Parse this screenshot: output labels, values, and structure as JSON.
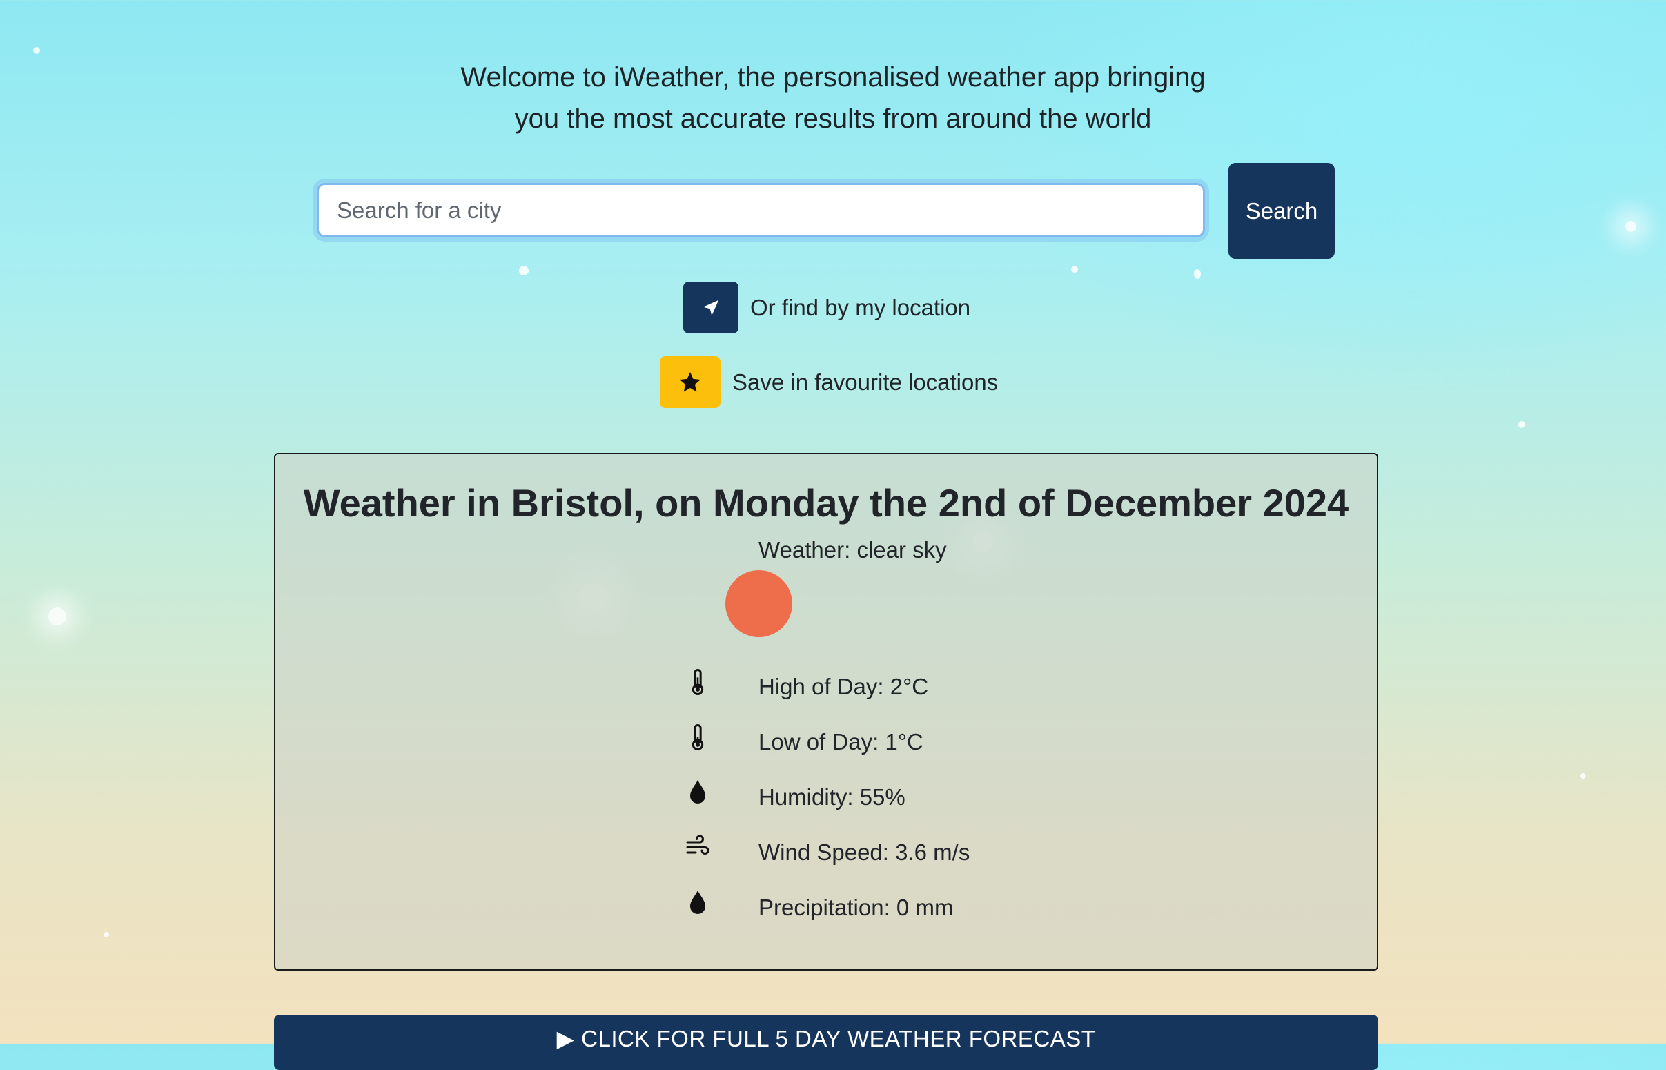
{
  "intro": {
    "line1": "Welcome to iWeather, the personalised weather app bringing",
    "line2": "you the most accurate results from around the world"
  },
  "search": {
    "placeholder": "Search for a city",
    "button_label": "Search"
  },
  "location": {
    "label": "Or find by my location",
    "icon": "location-arrow-icon"
  },
  "favourite": {
    "label": "Save in favourite locations",
    "icon": "star-icon"
  },
  "weather": {
    "title": "Weather in Bristol, on Monday the 2nd of December 2024",
    "description": "Weather: clear sky",
    "stats": [
      {
        "icon": "thermometer-icon",
        "text": "High of Day: 2°C"
      },
      {
        "icon": "thermometer-icon",
        "text": "Low of Day: 1°C"
      },
      {
        "icon": "droplet-icon",
        "text": "Humidity: 55%"
      },
      {
        "icon": "wind-icon",
        "text": "Wind Speed: 3.6 m/s"
      },
      {
        "icon": "droplet-icon",
        "text": "Precipitation: 0 mm"
      }
    ]
  },
  "forecast": {
    "toggle_label": "▶ CLICK FOR FULL 5 DAY WEATHER FORECAST"
  },
  "colors": {
    "primary": "#15355c",
    "accent": "#fbbf0c",
    "sun": "#ee6e4b"
  }
}
